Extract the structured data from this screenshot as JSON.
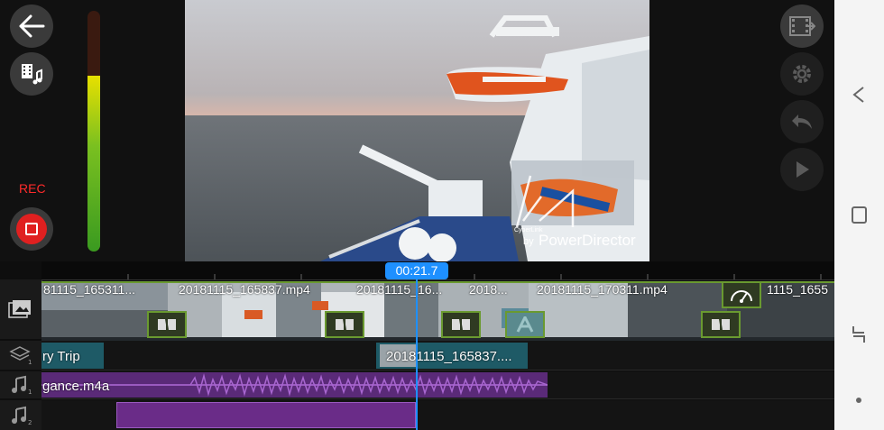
{
  "rec": {
    "label": "REC"
  },
  "meter": {
    "level": 0.73
  },
  "playhead": {
    "time": "00:21.7"
  },
  "watermark": {
    "by": "by",
    "brand": "PowerDirector",
    "small": "CyberLink"
  },
  "video_track": {
    "clips": [
      {
        "label": "81115_165311..."
      },
      {
        "label": "20181115_165837.mp4"
      },
      {
        "label": "20181115_16..."
      },
      {
        "label": "2018..."
      },
      {
        "label": "20181115_170311.mp4"
      },
      {
        "label": "1115_1655"
      }
    ]
  },
  "overlay_track": {
    "clips": [
      {
        "label": "ry Trip"
      },
      {
        "label": "20181115_165837...."
      }
    ]
  },
  "audio_track_1": {
    "label": "gance.m4a"
  },
  "colors": {
    "accent": "#1e90ff",
    "track_green": "#6a9a30",
    "audio_purple": "#7a3a9a",
    "overlay_teal": "#1e5a66",
    "rec_red": "#e02020"
  },
  "icons": [
    "back-arrow-icon",
    "media-library-icon",
    "record-icon",
    "produce-icon",
    "settings-icon",
    "undo-icon",
    "play-icon",
    "video-track-icon",
    "layers-icon",
    "music-note-icon",
    "speed-icon",
    "nav-back-icon",
    "nav-recent-icon",
    "nav-home-icon",
    "nav-overview-icon"
  ]
}
